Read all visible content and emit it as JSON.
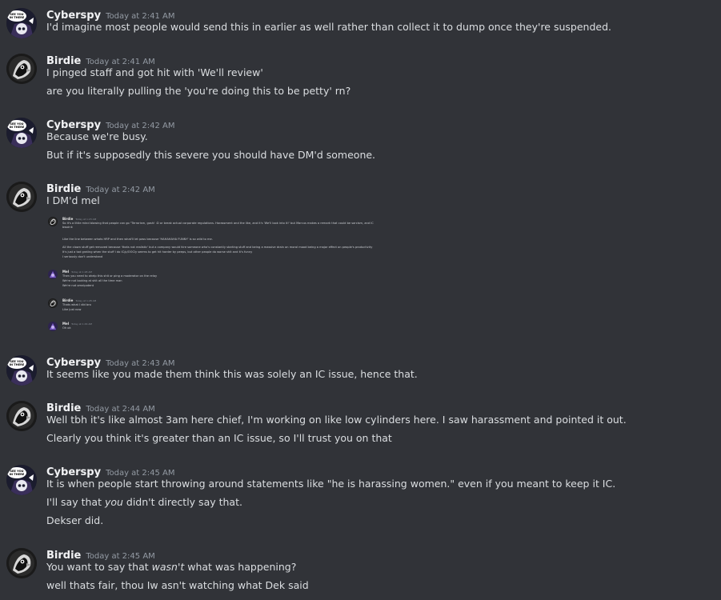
{
  "messages": [
    {
      "user": "Cyberspy",
      "time": "Today at 2:41 AM",
      "avatar": "cyberspy-avatar",
      "lines": [
        "I'd imagine most people would send this in earlier as well rather than collect it to dump once they're suspended."
      ]
    },
    {
      "user": "Birdie",
      "time": "Today at 2:41 AM",
      "avatar": "birdie-avatar",
      "lines": [
        "I pinged staff and got hit with 'We'll review'",
        "are you literally pulling the 'you're doing this to be petty' rn?"
      ]
    },
    {
      "user": "Cyberspy",
      "time": "Today at 2:42 AM",
      "avatar": "cyberspy-avatar",
      "lines": [
        "Because we're busy.",
        "But if it's supposedly this severe you should have DM'd someone."
      ]
    },
    {
      "user": "Birdie",
      "time": "Today at 2:42 AM",
      "avatar": "birdie-avatar",
      "lines": [
        "I DM'd mel"
      ]
    },
    {
      "user": "Cyberspy",
      "time": "Today at 2:43 AM",
      "avatar": "cyberspy-avatar",
      "lines": [
        "It seems like you made them think this was solely an IC issue, hence that."
      ]
    },
    {
      "user": "Birdie",
      "time": "Today at 2:44 AM",
      "avatar": "birdie-avatar",
      "lines": [
        "Well tbh it's like almost 3am here chief, I'm working on like low cylinders here. I saw harassment and pointed it out.",
        "Clearly you think it's greater than an IC issue, so I'll trust you on that"
      ]
    },
    {
      "user": "Cyberspy",
      "time": "Today at 2:45 AM",
      "avatar": "cyberspy-avatar",
      "lines": [
        "It is when people start throwing around statements like \"he is harassing women.\" even if you meant to keep it IC.",
        "I'll say that you didn't directly say that.",
        "Dekser did."
      ]
    },
    {
      "user": "Birdie",
      "time": "Today at 2:45 AM",
      "avatar": "birdie-avatar",
      "lines": [
        "You want to say that wasn't what was happening?",
        "well thats fair, thou Iw asn't watching what Dek said"
      ]
    }
  ],
  "attachment": {
    "messages": [
      {
        "user": "Birdie",
        "time": "Today at 1:23 AM",
        "avatar": "birdie-avatar",
        "lines": [
          "So it's a little mind blowing that people can go \"Terrorism, gosh! :D or break actual corporate regulations. Harassment and the like, and it's 'We'll look into it!' but Marcus makes a remark that could be sarcism, and IC",
          "bwoink",
          "",
          "Like the line between whats HRP and then what'll let pass because 'HAHAHAHA FUNNY' is so wild to me.",
          "All the clown stuff get removed because 'thats not realistic' but a company would hire someone who's constantly starting stuff and being a massive drain on moral mood being a major effect on people's productivity",
          "It's just a tad grating when the stuff I do IC/p/OOCly seems to get hit harder by peeps, but other people do worse shit and it's funny",
          "I seriously don't understand"
        ]
      },
      {
        "user": "Mel",
        "time": "Today at 1:28 AM",
        "avatar": "mel-avatar",
        "lines": [
          "Then you need to ahelp this shit or ping a moderator on the relay",
          "We're not looking at shit all the time man",
          "We're not omnipotent"
        ]
      },
      {
        "user": "Birdie",
        "time": "Today at 1:28 AM",
        "avatar": "birdie-avatar",
        "lines": [
          "Thats what I did bro",
          "Like just now"
        ]
      },
      {
        "user": "Mel",
        "time": "Today at 1:29 AM",
        "avatar": "mel-avatar",
        "lines": [
          "Oh ok"
        ]
      }
    ]
  },
  "colors": {
    "background": "#313338",
    "username": "#f2f3f5",
    "timestamp": "#949ba4",
    "text": "#dbdee1"
  }
}
